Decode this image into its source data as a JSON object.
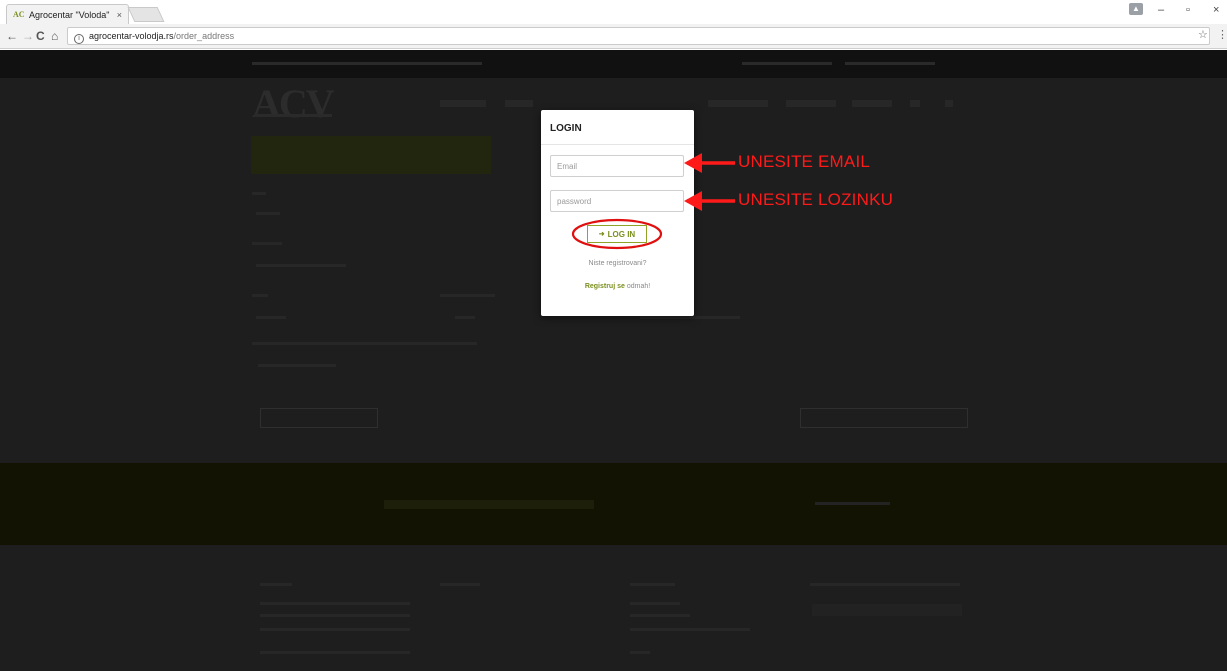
{
  "browser": {
    "tab_title": "Agrocentar \"Voloda\"",
    "tab_logo_text": "AC",
    "tab_close": "×",
    "url_host": "agrocentar-volodja.rs",
    "url_path": "/order_address",
    "back": "←",
    "forward": "→",
    "reload": "C",
    "home": "⌂",
    "star": "☆",
    "menu": "⋮",
    "minimize": "–",
    "maximize": "▫",
    "close": "×"
  },
  "site": {
    "logo": "ACV"
  },
  "modal": {
    "title": "LOGIN",
    "email_placeholder": "Email",
    "password_placeholder": "password",
    "login_button": "LOG IN",
    "not_registered": "Niste registrovani?",
    "register_bold": "Registruj se",
    "register_rest": " odmah!"
  },
  "annotations": {
    "email_hint": "UNESITE EMAIL",
    "password_hint": "UNESITE LOZINKU",
    "color": "#ff1a1a"
  },
  "colors": {
    "accent": "#7a8f1e",
    "overlay": "#1e1e1e"
  }
}
